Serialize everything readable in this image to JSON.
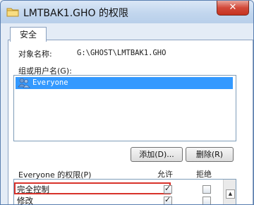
{
  "window": {
    "title": "LMTBAK1.GHO 的权限",
    "close_label": "✕"
  },
  "tabs": [
    {
      "label": "安全"
    }
  ],
  "object": {
    "label": "对象名称:",
    "value": "G:\\GHOST\\LMTBAK1.GHO"
  },
  "group_list": {
    "label": "组或用户名(G):",
    "items": [
      {
        "name": "Everyone",
        "selected": true,
        "icon": "users-icon"
      }
    ]
  },
  "buttons": {
    "add": "添加(D)...",
    "remove": "删除(R)"
  },
  "permissions": {
    "header": "Everyone 的权限(P)",
    "allow_header": "允许",
    "deny_header": "拒绝",
    "rows": [
      {
        "label": "完全控制",
        "allow": true,
        "deny": false
      },
      {
        "label": "修改",
        "allow": true,
        "deny": false
      }
    ]
  },
  "colors": {
    "selection": "#3399ff",
    "highlight_border": "#d8332b"
  }
}
